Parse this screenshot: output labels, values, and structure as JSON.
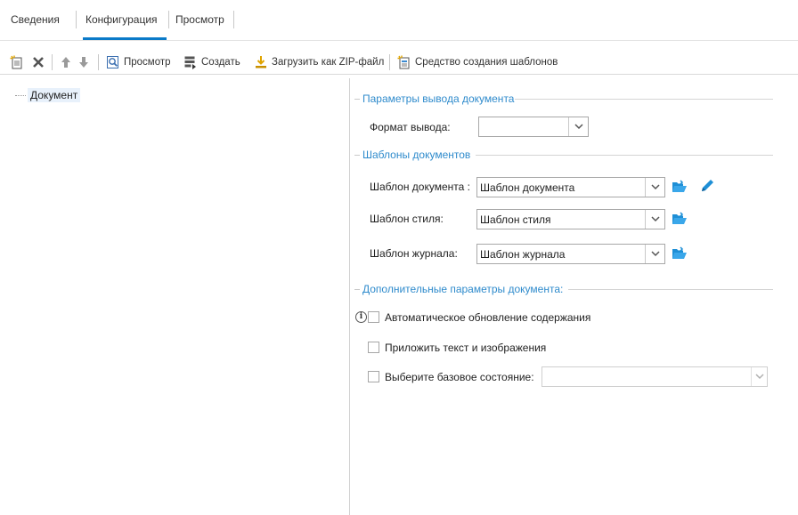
{
  "tabs": [
    {
      "label": "Сведения"
    },
    {
      "label": "Конфигурация"
    },
    {
      "label": "Просмотр"
    }
  ],
  "toolbar": {
    "new_icon": "new-document-icon",
    "delete_icon": "delete-icon",
    "move_up_icon": "arrow-up-icon",
    "move_down_icon": "arrow-down-icon",
    "preview_label": "Просмотр",
    "create_label": "Создать",
    "download_zip_label": "Загрузить как ZIP-файл",
    "template_tool_label": "Средство создания шаблонов"
  },
  "tree": {
    "root_label": "Документ"
  },
  "output_section": {
    "title": "Параметры вывода документа",
    "format_label": "Формат вывода:",
    "format_value": ""
  },
  "templates_section": {
    "title": "Шаблоны документов",
    "document_template_label": "Шаблон документа :",
    "document_template_value": "Шаблон документа",
    "style_template_label": "Шаблон стиля:",
    "style_template_value": "Шаблон стиля",
    "journal_template_label": "Шаблон журнала:",
    "journal_template_value": "Шаблон журнала"
  },
  "additional_section": {
    "title": "Дополнительные параметры документа:",
    "auto_update_toc_label": "Автоматическое обновление содержания",
    "auto_update_toc_checked": false,
    "attach_text_images_label": "Приложить текст и изображения",
    "attach_text_images_checked": false,
    "baseline_label": "Выберите базовое состояние:",
    "baseline_checked": false,
    "baseline_value": ""
  },
  "colors": {
    "accent": "#0a7ac8",
    "section_title": "#2f8bcc",
    "folder_icon": "#1e8fd6"
  }
}
